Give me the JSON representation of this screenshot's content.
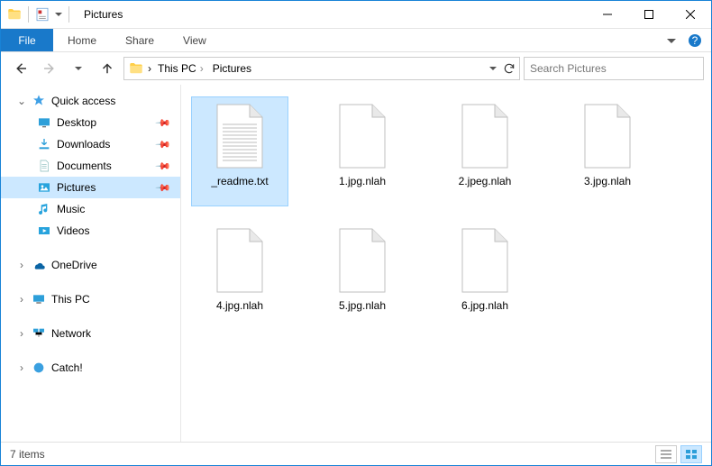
{
  "title": "Pictures",
  "ribbon": {
    "file": "File",
    "tabs": [
      "Home",
      "Share",
      "View"
    ]
  },
  "breadcrumb": [
    "This PC",
    "Pictures"
  ],
  "search_placeholder": "Search Pictures",
  "nav": {
    "quick": "Quick access",
    "quick_items": [
      "Desktop",
      "Downloads",
      "Documents",
      "Pictures",
      "Music",
      "Videos"
    ],
    "onedrive": "OneDrive",
    "thispc": "This PC",
    "network": "Network",
    "catch": "Catch!"
  },
  "files": [
    {
      "name": "_readme.txt",
      "kind": "txt",
      "selected": true
    },
    {
      "name": "1.jpg.nlah",
      "kind": "blank"
    },
    {
      "name": "2.jpeg.nlah",
      "kind": "blank"
    },
    {
      "name": "3.jpg.nlah",
      "kind": "blank"
    },
    {
      "name": "4.jpg.nlah",
      "kind": "blank"
    },
    {
      "name": "5.jpg.nlah",
      "kind": "blank"
    },
    {
      "name": "6.jpg.nlah",
      "kind": "blank"
    }
  ],
  "status": "7 items",
  "colors": {
    "accent": "#1979ca",
    "selection": "#cce8ff"
  }
}
